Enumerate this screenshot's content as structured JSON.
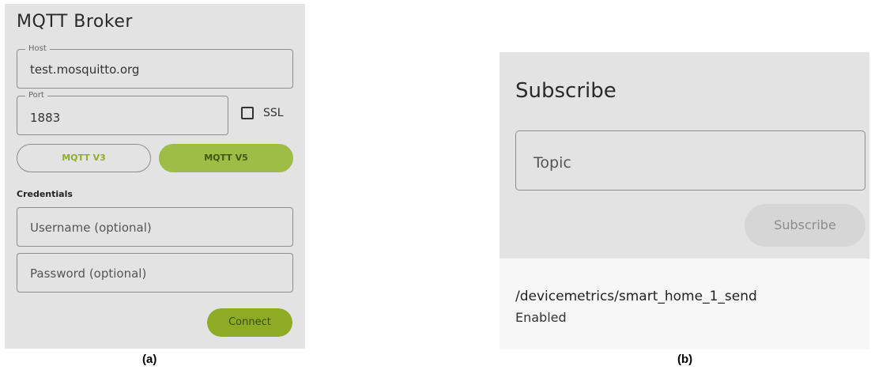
{
  "panel_a": {
    "title": "MQTT Broker",
    "host": {
      "label": "Host",
      "value": "test.mosquitto.org"
    },
    "port": {
      "label": "Port",
      "value": "1883"
    },
    "ssl": {
      "label": "SSL",
      "checked": false
    },
    "protocol": {
      "v3_label": "MQTT V3",
      "v5_label": "MQTT V5",
      "selected": "MQTT V5"
    },
    "credentials": {
      "label": "Credentials",
      "username_placeholder": "Username (optional)",
      "password_placeholder": "Password (optional)"
    },
    "connect_label": "Connect",
    "caption": "(a)"
  },
  "panel_b": {
    "title": "Subscribe",
    "topic_placeholder": "Topic",
    "subscribe_label": "Subscribe",
    "subscription": {
      "topic": "/devicemetrics/smart_home_1_send",
      "status": "Enabled"
    },
    "caption": "(b)"
  },
  "colors": {
    "accent_selected": "#9dbd46",
    "accent_connect": "#8eab25",
    "panel_bg": "#e3e3e3"
  }
}
